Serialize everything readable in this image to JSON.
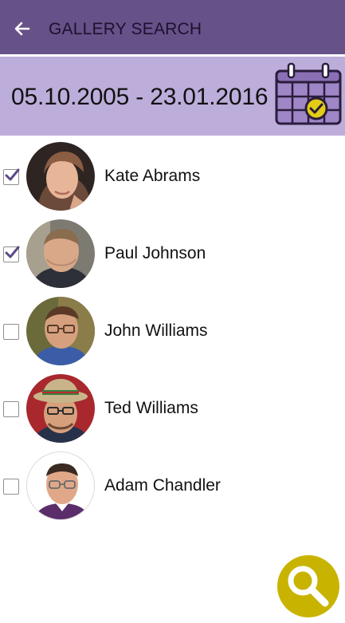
{
  "header": {
    "title": "GALLERY SEARCH",
    "back_icon": "arrow-left-icon",
    "bg_color": "#665188"
  },
  "date_filter": {
    "range": "05.10.2005 - 23.01.2016",
    "calendar_icon": "calendar-check-icon",
    "bg_color": "#bdaddb"
  },
  "people": [
    {
      "name": "Kate Abrams",
      "checked": true
    },
    {
      "name": "Paul Johnson",
      "checked": true
    },
    {
      "name": "John Williams",
      "checked": false
    },
    {
      "name": "Ted Williams",
      "checked": false
    },
    {
      "name": "Adam Chandler",
      "checked": false
    }
  ],
  "search_button": {
    "icon": "magnifier-icon",
    "color": "#c8b400"
  }
}
